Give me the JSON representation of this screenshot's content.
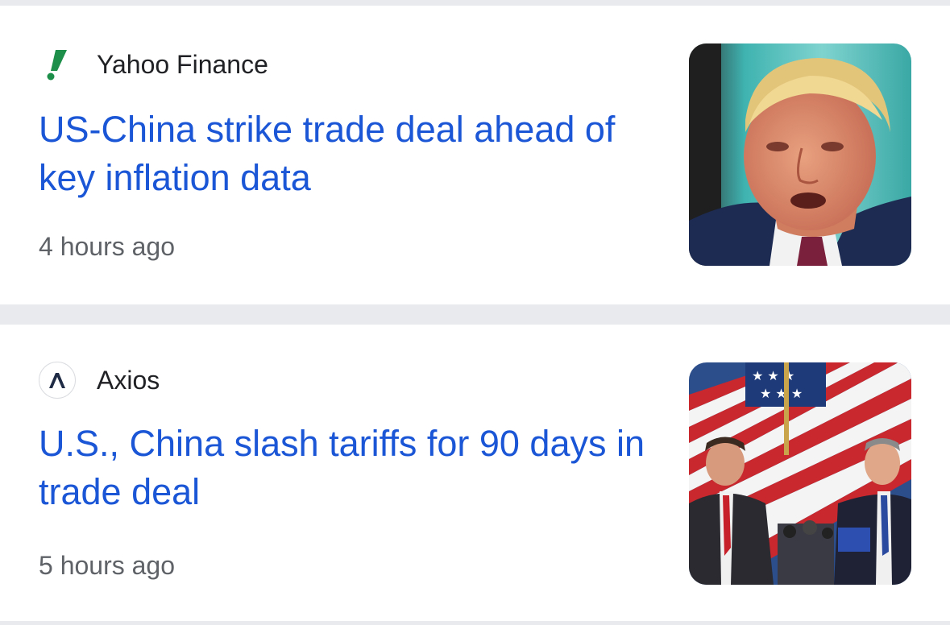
{
  "articles": [
    {
      "source": "Yahoo Finance",
      "source_logo_icon": "yahoo-finance-exclamation-icon",
      "headline": "US-China strike trade deal ahead of key inflation data",
      "time": "4 hours ago",
      "thumbnail": "trump-portrait-image"
    },
    {
      "source": "Axios",
      "source_logo_icon": "axios-logo-icon",
      "headline": "U.S., China slash tariffs for 90 days in trade deal",
      "time": "5 hours ago",
      "thumbnail": "press-conference-flag-image"
    }
  ],
  "colors": {
    "headline": "#1a56d6",
    "source_text": "#202124",
    "timestamp": "#5f6368",
    "separator": "#e8eaed",
    "yahoo_green": "#1e8f4a",
    "axios_navy": "#1f2a44"
  }
}
